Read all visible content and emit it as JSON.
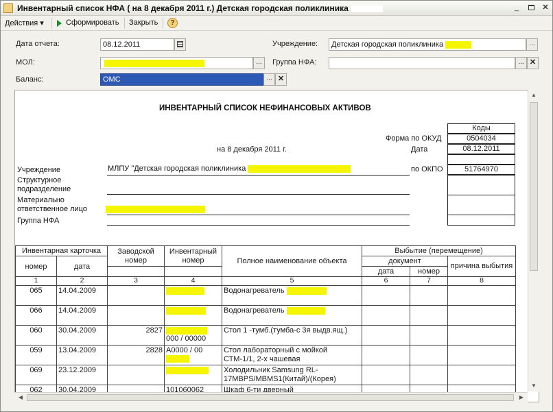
{
  "window": {
    "title": "Инвентарный список НФА ( на 8 декабря 2011 г.) Детская городская поликлиника",
    "min_label": "_"
  },
  "toolbar": {
    "actions_label": "Действия",
    "form_label": "Сформировать",
    "close_label": "Закрыть",
    "help_label": "?"
  },
  "form": {
    "report_date_label": "Дата отчета:",
    "report_date_value": "08.12.2011",
    "mol_label": "МОЛ:",
    "balance_label": "Баланс:",
    "balance_value": "ОМС",
    "institution_label": "Учреждение:",
    "institution_value": "Детская городская поликлиника",
    "nfa_group_label": "Группа НФА:",
    "nfa_group_value": ""
  },
  "report": {
    "title": "ИНВЕНТАРНЫЙ СПИСОК НЕФИНАНСОВЫХ АКТИВОВ",
    "date_line": "на 8 декабря 2011 г.",
    "codes_header": "Коды",
    "okud_label": "Форма по ОКУД",
    "okud_value": "0504034",
    "date_label": "Дата",
    "date_value": "08.12.2011",
    "okpo_label": "по ОКПО",
    "okpo_value": "51764970",
    "institution_label": "Учреждение",
    "institution_value": "МЛПУ \"Детская городская поликлиника",
    "structural_label_1": "Структурное",
    "structural_label_2": "подразделение",
    "responsible_label_1": "Материально",
    "responsible_label_2": "ответственное лицо",
    "nfa_group_label": "Группа НФА"
  },
  "table": {
    "header": {
      "inv_card": "Инвентарная карточка",
      "number": "номер",
      "date": "дата",
      "factory_number": "Заводской номер",
      "inventory_number": "Инвентарный номер",
      "full_name": "Полное наименование объекта",
      "disposal": "Выбытие (перемещение)",
      "document": "документ",
      "doc_date": "дата",
      "doc_number": "номер",
      "reason": "причина выбытия"
    },
    "column_numbers": [
      "1",
      "2",
      "3",
      "4",
      "5",
      "6",
      "7",
      "8"
    ],
    "rows": [
      {
        "number": "065",
        "date": "14.04.2009",
        "factory": "",
        "inventory": "",
        "name": "Водонагреватель"
      },
      {
        "number": "066",
        "date": "14.04.2009",
        "factory": "",
        "inventory": "",
        "name": "Водонагреватель"
      },
      {
        "number": "060",
        "date": "30.04.2009",
        "factory": "2827",
        "inventory": "000 / 00000",
        "name": "Стол 1 -тумб.(тумба-с 3я выдв.ящ.)"
      },
      {
        "number": "059",
        "date": "13.04.2009",
        "factory": "2828",
        "inventory": "А0000 / 00",
        "name": "Стол лабораторный с мойкой СТМ-1/1, 2-х чашевая"
      },
      {
        "number": "069",
        "date": "23.12.2009",
        "factory": "",
        "inventory": "",
        "name": "Холодильник Samsung RL-17MBPS/MBMS1(Китай)/(Корея)"
      },
      {
        "number": "062",
        "date": "30.04.2009",
        "factory": "",
        "inventory": "101060062",
        "name": "Шкаф 6-ти дверный"
      }
    ]
  }
}
